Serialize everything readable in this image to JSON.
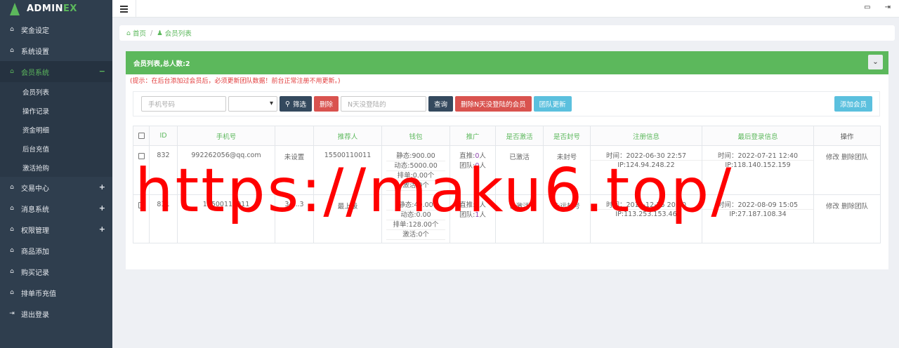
{
  "brand": {
    "name_main": "ADMIN",
    "name_accent": "EX"
  },
  "sidebar": {
    "items": [
      {
        "label": "奖金设定",
        "icon": "home-icon"
      },
      {
        "label": "系统设置",
        "icon": "home-icon"
      },
      {
        "label": "会员系统",
        "icon": "home-icon",
        "toggle": "−",
        "active": true
      },
      {
        "label": "交易中心",
        "icon": "home-icon",
        "toggle": "+"
      },
      {
        "label": "消息系统",
        "icon": "home-icon",
        "toggle": "+"
      },
      {
        "label": "权限管理",
        "icon": "home-icon",
        "toggle": "+"
      },
      {
        "label": "商品添加",
        "icon": "home-icon"
      },
      {
        "label": "购买记录",
        "icon": "home-icon"
      },
      {
        "label": "排单币充值",
        "icon": "home-icon"
      },
      {
        "label": "退出登录",
        "icon": "logout-icon"
      }
    ],
    "subitems": [
      "会员列表",
      "操作记录",
      "资金明细",
      "后台充值",
      "激活抢购"
    ]
  },
  "breadcrumb": {
    "home": "首页",
    "current": "会员列表"
  },
  "panel": {
    "title": "会员列表,总人数:2",
    "hint": "(提示：在后台添加过会员后，必须更新团队数据！前台正常注册不用更新。)"
  },
  "toolbar": {
    "phone_placeholder": "手机号码",
    "filter_label": "筛选",
    "delete_label": "删除",
    "days_placeholder": "N天没登陆的",
    "query_label": "查询",
    "delete_inactive_label": "删除N天没登陆的会员",
    "update_team_label": "团队更新",
    "add_member_label": "添加会员"
  },
  "table": {
    "headers": [
      "ID",
      "手机号",
      "",
      "推荐人",
      "钱包",
      "推广",
      "是否激活",
      "是否封号",
      "注册信息",
      "最后登录信息",
      "操作"
    ],
    "rows": [
      {
        "id": "832",
        "phone": "992262056@qq.com",
        "name": "未设置",
        "referrer": "15500110011",
        "wallet": [
          "静态:900.00",
          "动态:5000.00",
          "排单:0.00个",
          "激活:0个"
        ],
        "promo_direct_label": "直推:",
        "promo_direct_num": "0",
        "promo_direct_unit": "人",
        "promo_team_label": "团队:",
        "promo_team_num": "0",
        "promo_team_unit": "人",
        "activated": "已激活",
        "banned": "未封号",
        "reg_time": "时间：2022-06-30 22:57",
        "reg_ip": "IP:124.94.248.22",
        "login_time": "时间：2022-07-21 12:40",
        "login_ip": "IP:118.140.152.159",
        "op_edit": "修改",
        "op_delete": "删除团队"
      },
      {
        "id": "831",
        "phone": "15500110011",
        "name": "34...3",
        "referrer": "最上级",
        "wallet": [
          "静态:40.00",
          "动态:0.00",
          "排单:128.00个",
          "激活:0个"
        ],
        "promo_direct_label": "直推:",
        "promo_direct_num": "1",
        "promo_direct_unit": "人",
        "promo_team_label": "团队:",
        "promo_team_num": "1",
        "promo_team_unit": "人",
        "activated": "已激活",
        "banned": "永远封号",
        "reg_time": "时间：2019-12-25 20:10",
        "reg_ip": "IP:113.253.153.46",
        "login_time": "时间：2022-08-09 15:05",
        "login_ip": "IP:27.187.108.34",
        "op_edit": "修改",
        "op_delete": "删除团队"
      }
    ]
  },
  "watermark": "https://maku6.top/",
  "colors": {
    "sidebar": "#2f3e4e",
    "accent": "#5cb85c",
    "danger": "#d9534f",
    "info": "#5bc0de",
    "dark": "#34495e"
  }
}
